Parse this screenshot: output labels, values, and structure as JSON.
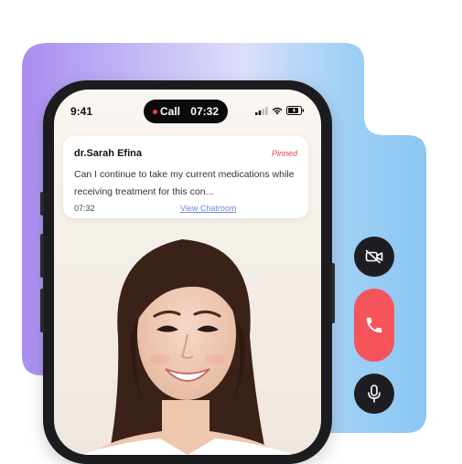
{
  "status_bar": {
    "time": "9:41"
  },
  "call_pill": {
    "label": "Call",
    "duration": "07:32"
  },
  "message_card": {
    "doctor_name": "dr.Sarah Efina",
    "pinned_label": "Pinned",
    "message": "Can I continue to take my current medications while receiving treatment for this con...",
    "time": "07:32",
    "link_label": "View Chatroom"
  },
  "controls": {
    "video_icon": "video-off-icon",
    "end_icon": "phone-icon",
    "mic_icon": "microphone-icon"
  },
  "colors": {
    "end_call": "#f5545a",
    "control_dark": "#1e1e22",
    "pinned": "#e0474a",
    "link": "#6a8cd8",
    "gradient_left": "#a98df0",
    "gradient_right": "#8fc9f3"
  }
}
